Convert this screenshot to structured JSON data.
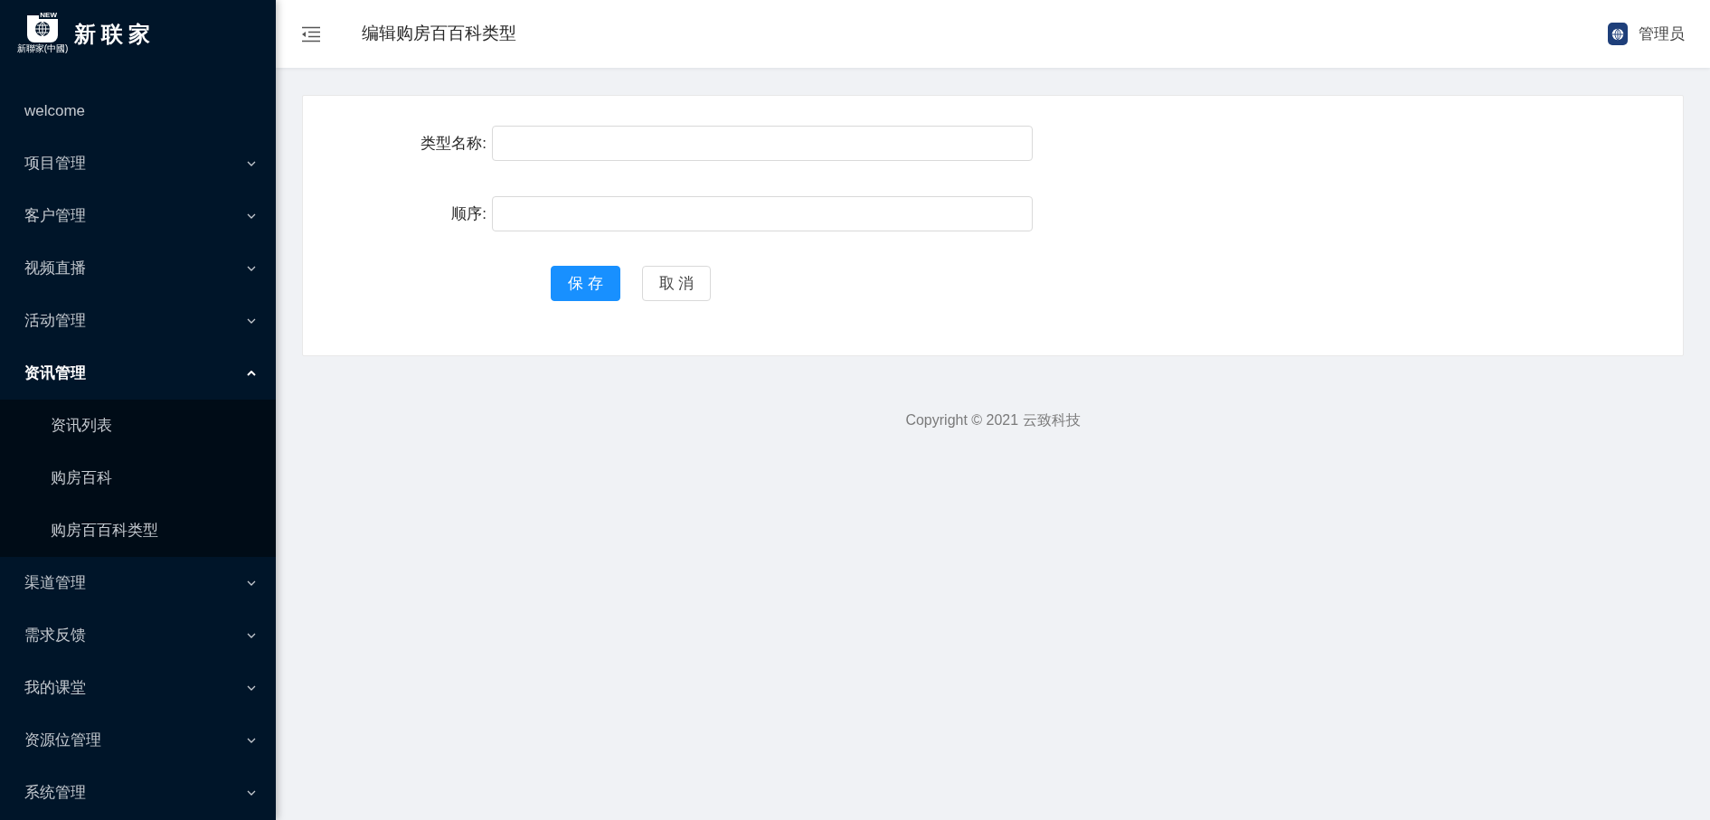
{
  "sidebar": {
    "logo": {
      "badge": "NEW",
      "caption": "新聯家(中國)",
      "name": "新联家"
    },
    "items": [
      {
        "label": "welcome",
        "kind": "link"
      },
      {
        "label": "项目管理",
        "kind": "group",
        "expanded": false
      },
      {
        "label": "客户管理",
        "kind": "group",
        "expanded": false
      },
      {
        "label": "视频直播",
        "kind": "group",
        "expanded": false
      },
      {
        "label": "活动管理",
        "kind": "group",
        "expanded": false
      },
      {
        "label": "资讯管理",
        "kind": "group",
        "expanded": true,
        "children": [
          {
            "label": "资讯列表"
          },
          {
            "label": "购房百科"
          },
          {
            "label": "购房百百科类型"
          }
        ]
      },
      {
        "label": "渠道管理",
        "kind": "group",
        "expanded": false
      },
      {
        "label": "需求反馈",
        "kind": "group",
        "expanded": false
      },
      {
        "label": "我的课堂",
        "kind": "group",
        "expanded": false
      },
      {
        "label": "资源位管理",
        "kind": "group",
        "expanded": false
      },
      {
        "label": "系统管理",
        "kind": "group",
        "expanded": false
      }
    ]
  },
  "header": {
    "title": "编辑购房百百科类型",
    "user": "管理员"
  },
  "form": {
    "fields": [
      {
        "label": "类型名称:"
      },
      {
        "label": "顺序:"
      }
    ],
    "buttons": [
      {
        "label": "保 存",
        "kind": "primary"
      },
      {
        "label": "取 消",
        "kind": "default"
      }
    ]
  },
  "footer": "Copyright © 2021 云致科技"
}
